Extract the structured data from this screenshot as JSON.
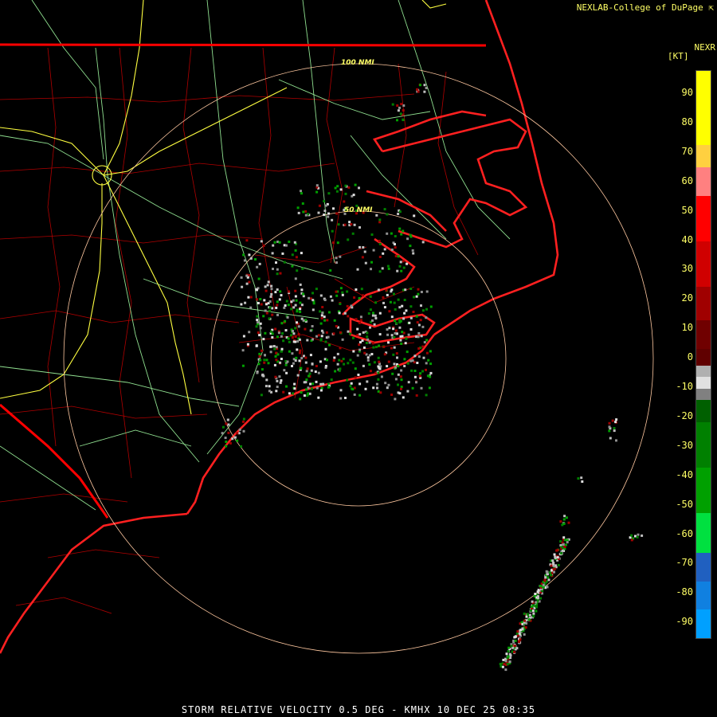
{
  "credit": "NEXLAB-College of DuPage",
  "credit_icon": "cursor-arrow-icon",
  "product": {
    "label": "NEXR",
    "unit": "[KT]"
  },
  "footer": "STORM RELATIVE VELOCITY 0.5 DEG - KMHX 10 DEC 25 08:35",
  "range_rings": [
    "100 NMI",
    "50 NMI"
  ],
  "legend": {
    "ticks": [
      "90",
      "80",
      "70",
      "60",
      "50",
      "40",
      "30",
      "20",
      "10",
      "0",
      "-10",
      "-20",
      "-30",
      "-40",
      "-50",
      "-60",
      "-70",
      "-80",
      "-90"
    ],
    "colors": {
      "inbound_strong": "#00a0ff",
      "inbound": "#00c040",
      "neutral": "#b0b0b0",
      "outbound": "#ff0000",
      "outbound_strong": "#ffff00"
    }
  },
  "map_colors": {
    "state_borders": "#ff0000",
    "county_lines": "#c00000",
    "highways": "#90e090",
    "interstates": "#ffff40",
    "range_rings": "#ffc8a0"
  }
}
